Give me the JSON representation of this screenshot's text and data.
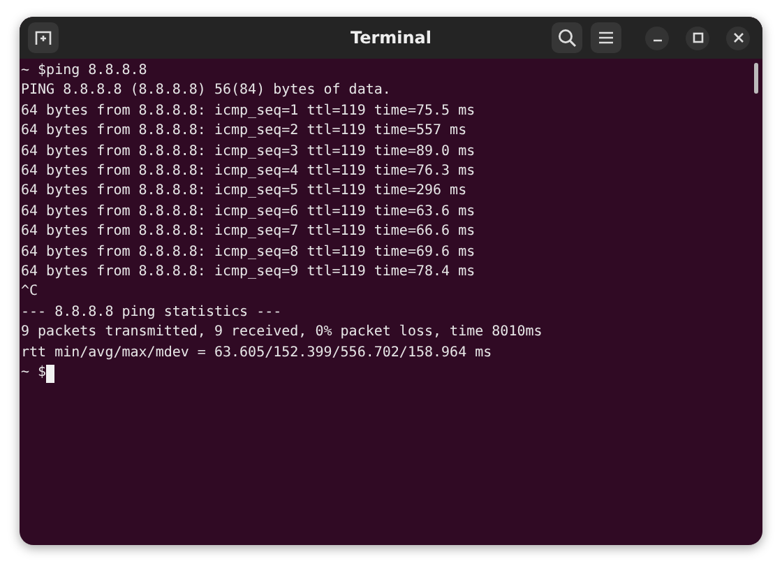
{
  "window": {
    "title": "Terminal"
  },
  "terminal": {
    "lines": [
      "~ $ping 8.8.8.8",
      "PING 8.8.8.8 (8.8.8.8) 56(84) bytes of data.",
      "64 bytes from 8.8.8.8: icmp_seq=1 ttl=119 time=75.5 ms",
      "64 bytes from 8.8.8.8: icmp_seq=2 ttl=119 time=557 ms",
      "64 bytes from 8.8.8.8: icmp_seq=3 ttl=119 time=89.0 ms",
      "64 bytes from 8.8.8.8: icmp_seq=4 ttl=119 time=76.3 ms",
      "64 bytes from 8.8.8.8: icmp_seq=5 ttl=119 time=296 ms",
      "64 bytes from 8.8.8.8: icmp_seq=6 ttl=119 time=63.6 ms",
      "64 bytes from 8.8.8.8: icmp_seq=7 ttl=119 time=66.6 ms",
      "64 bytes from 8.8.8.8: icmp_seq=8 ttl=119 time=69.6 ms",
      "64 bytes from 8.8.8.8: icmp_seq=9 ttl=119 time=78.4 ms",
      "^C",
      "--- 8.8.8.8 ping statistics ---",
      "9 packets transmitted, 9 received, 0% packet loss, time 8010ms",
      "rtt min/avg/max/mdev = 63.605/152.399/556.702/158.964 ms"
    ],
    "prompt": "~ $"
  }
}
